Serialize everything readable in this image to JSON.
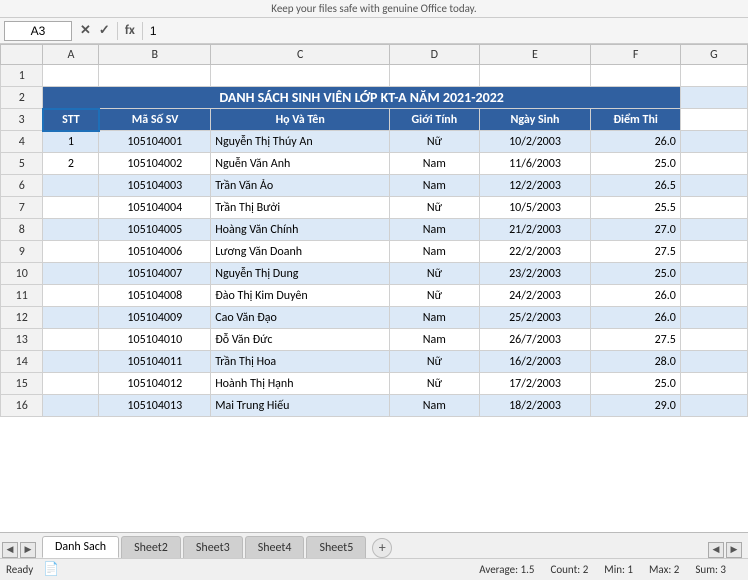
{
  "topbar": {
    "message": "Keep your files safe with genuine Office today."
  },
  "formulaBar": {
    "cellRef": "A3",
    "cancelBtn": "✕",
    "confirmBtn": "✓",
    "funcBtn": "fx",
    "value": "1"
  },
  "colHeaders": [
    "",
    "A",
    "B",
    "C",
    "D",
    "E",
    "F",
    "G"
  ],
  "title": {
    "text": "DANH SÁCH SINH VIÊN LỚP KT-A NĂM 2021-2022"
  },
  "tableHeaders": {
    "stt": "STT",
    "mssv": "Mã Số SV",
    "hoten": "Họ Và Tên",
    "gioitinh": "Giới Tính",
    "ngaysinh": "Ngày Sinh",
    "diemthi": "Điểm Thi"
  },
  "rows": [
    {
      "stt": "1",
      "mssv": "105104001",
      "hoten": "Nguyễn Thị Thúy An",
      "gioitinh": "Nữ",
      "ngaysinh": "10/2/2003",
      "diemthi": "26.0"
    },
    {
      "stt": "2",
      "mssv": "105104002",
      "hoten": "Nguễn Văn Anh",
      "gioitinh": "Nam",
      "ngaysinh": "11/6/2003",
      "diemthi": "25.0"
    },
    {
      "stt": "",
      "mssv": "105104003",
      "hoten": "Trần Văn Ảo",
      "gioitinh": "Nam",
      "ngaysinh": "12/2/2003",
      "diemthi": "26.5"
    },
    {
      "stt": "",
      "mssv": "105104004",
      "hoten": "Trần Thị Bưởi",
      "gioitinh": "Nữ",
      "ngaysinh": "10/5/2003",
      "diemthi": "25.5"
    },
    {
      "stt": "",
      "mssv": "105104005",
      "hoten": "Hoàng Văn Chính",
      "gioitinh": "Nam",
      "ngaysinh": "21/2/2003",
      "diemthi": "27.0"
    },
    {
      "stt": "",
      "mssv": "105104006",
      "hoten": "Lương Văn Doanh",
      "gioitinh": "Nam",
      "ngaysinh": "22/2/2003",
      "diemthi": "27.5"
    },
    {
      "stt": "",
      "mssv": "105104007",
      "hoten": "Nguyễn Thị Dung",
      "gioitinh": "Nữ",
      "ngaysinh": "23/2/2003",
      "diemthi": "25.0"
    },
    {
      "stt": "",
      "mssv": "105104008",
      "hoten": "Đào Thị Kim Duyên",
      "gioitinh": "Nữ",
      "ngaysinh": "24/2/2003",
      "diemthi": "26.0"
    },
    {
      "stt": "",
      "mssv": "105104009",
      "hoten": "Cao Văn Đạo",
      "gioitinh": "Nam",
      "ngaysinh": "25/2/2003",
      "diemthi": "26.0"
    },
    {
      "stt": "",
      "mssv": "105104010",
      "hoten": "Đỗ Văn Đức",
      "gioitinh": "Nam",
      "ngaysinh": "26/7/2003",
      "diemthi": "27.5"
    },
    {
      "stt": "",
      "mssv": "105104011",
      "hoten": "Trần Thị Hoa",
      "gioitinh": "Nữ",
      "ngaysinh": "16/2/2003",
      "diemthi": "28.0"
    },
    {
      "stt": "",
      "mssv": "105104012",
      "hoten": "Hoành Thị Hạnh",
      "gioitinh": "Nữ",
      "ngaysinh": "17/2/2003",
      "diemthi": "25.0"
    },
    {
      "stt": "",
      "mssv": "105104013",
      "hoten": "Mai Trung Hiếu",
      "gioitinh": "Nam",
      "ngaysinh": "18/2/2003",
      "diemthi": "29.0"
    }
  ],
  "rowNumbers": [
    "1",
    "2",
    "3",
    "4",
    "5",
    "6",
    "7",
    "8",
    "9",
    "10",
    "11",
    "12",
    "13",
    "14",
    "15"
  ],
  "sheets": [
    "Danh Sach",
    "Sheet2",
    "Sheet3",
    "Sheet4",
    "Sheet5"
  ],
  "activeSheet": "Danh Sach",
  "statusBar": {
    "ready": "Ready",
    "avg": "Average: 1.5",
    "count": "Count: 2",
    "min": "Min: 1",
    "max": "Max: 2",
    "sum": "Sum: 3"
  }
}
